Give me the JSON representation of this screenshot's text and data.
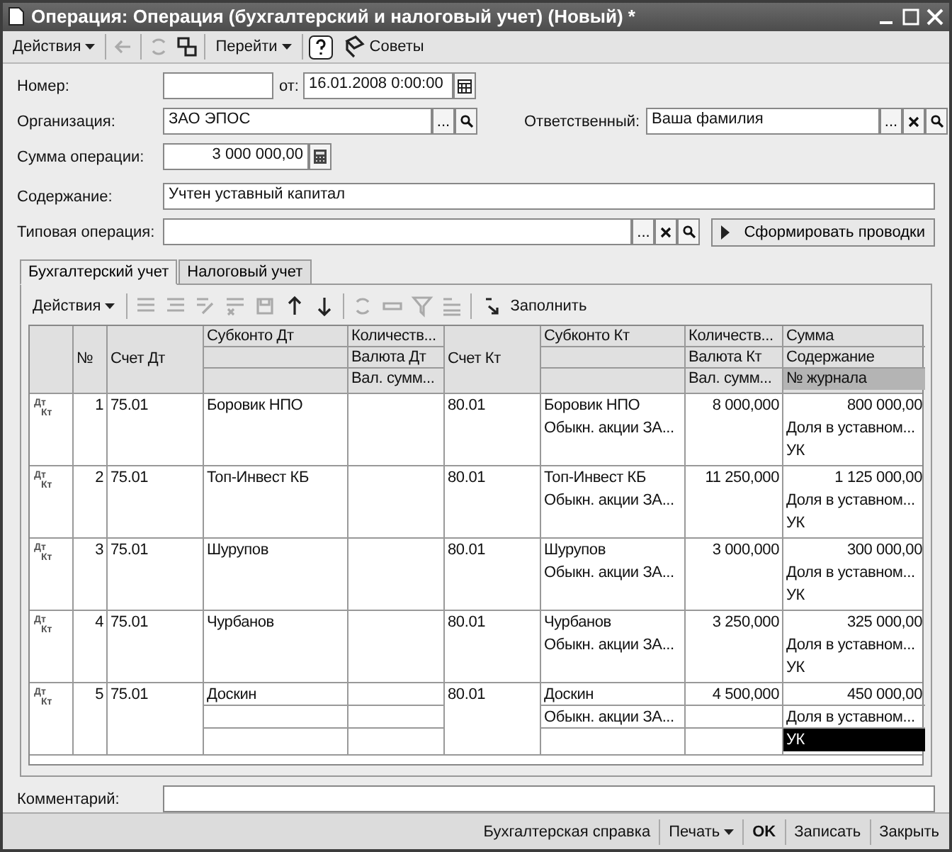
{
  "window": {
    "title": "Операция: Операция (бухгалтерский и налоговый учет) (Новый) *"
  },
  "toolbar": {
    "actions": "Действия",
    "goto": "Перейти",
    "tips": "Советы"
  },
  "form": {
    "number_label": "Номер:",
    "date_label": "от:",
    "date": "16.01.2008  0:00:00",
    "org_label": "Организация:",
    "org": "ЗАО ЭПОС",
    "resp_label": "Ответственный:",
    "resp": "Ваша фамилия",
    "sum_label": "Сумма операции:",
    "sum": "3 000 000,00",
    "content_label": "Содержание:",
    "content": "Учтен уставный капитал",
    "type_label": "Типовая операция:",
    "generate": "Сформировать проводки",
    "ellipsis": "..."
  },
  "tabs": [
    {
      "label": "Бухгалтерский учет",
      "selected": true
    },
    {
      "label": "Налоговый учет",
      "selected": false
    }
  ],
  "table_toolbar": {
    "actions": "Действия",
    "fill": "Заполнить"
  },
  "table": {
    "columns": [
      {
        "kind": "single"
      },
      {
        "kind": "single",
        "lines": [
          "№"
        ]
      },
      {
        "kind": "single",
        "lines": [
          "Счет Дт"
        ]
      },
      {
        "kind": "stacked",
        "lines": [
          "Субконто Дт"
        ]
      },
      {
        "kind": "stacked",
        "lines": [
          "Количеств...",
          "Валюта Дт",
          "Вал. сумм..."
        ]
      },
      {
        "kind": "single",
        "lines": [
          "Счет Кт"
        ]
      },
      {
        "kind": "stacked",
        "lines": [
          "Субконто Кт"
        ]
      },
      {
        "kind": "stacked",
        "lines": [
          "Количеств...",
          "Валюта Кт",
          "Вал. сумм..."
        ]
      },
      {
        "kind": "stacked",
        "lines": [
          "Сумма",
          "Содержание",
          "№ журнала"
        ],
        "sorted": true
      }
    ],
    "rows": [
      {
        "type_mark": [
          "Дт",
          "Кт"
        ],
        "n": "1",
        "dt": "75.01",
        "sub_dt": "Боровик НПО",
        "kt": "80.01",
        "sub_kt": [
          "Боровик НПО",
          "Обыкн. акции ЗА..."
        ],
        "qty": "8 000,000",
        "sum": "800 000,00",
        "text": "Доля в уставном...",
        "journal": "УК",
        "selected": false
      },
      {
        "type_mark": [
          "Дт",
          "Кт"
        ],
        "n": "2",
        "dt": "75.01",
        "sub_dt": "Топ-Инвест КБ",
        "kt": "80.01",
        "sub_kt": [
          "Топ-Инвест КБ",
          "Обыкн. акции ЗА..."
        ],
        "qty": "11 250,000",
        "sum": "1 125 000,00",
        "text": "Доля в уставном...",
        "journal": "УК",
        "selected": false
      },
      {
        "type_mark": [
          "Дт",
          "Кт"
        ],
        "n": "3",
        "dt": "75.01",
        "sub_dt": "Шурупов",
        "kt": "80.01",
        "sub_kt": [
          "Шурупов",
          "Обыкн. акции ЗА..."
        ],
        "qty": "3 000,000",
        "sum": "300 000,00",
        "text": "Доля в уставном...",
        "journal": "УК",
        "selected": false
      },
      {
        "type_mark": [
          "Дт",
          "Кт"
        ],
        "n": "4",
        "dt": "75.01",
        "sub_dt": "Чурбанов",
        "kt": "80.01",
        "sub_kt": [
          "Чурбанов",
          "Обыкн. акции ЗА..."
        ],
        "qty": "3 250,000",
        "sum": "325 000,00",
        "text": "Доля в уставном...",
        "journal": "УК",
        "selected": false
      },
      {
        "type_mark": [
          "Дт",
          "Кт"
        ],
        "n": "5",
        "dt": "75.01",
        "sub_dt": "Доскин",
        "kt": "80.01",
        "sub_kt": [
          "Доскин",
          "Обыкн. акции ЗА..."
        ],
        "qty": "4 500,000",
        "sum": "450 000,00",
        "text": "Доля в уставном...",
        "journal": "УК",
        "selected": true
      }
    ]
  },
  "comment": {
    "label": "Комментарий:"
  },
  "footer": {
    "report": "Бухгалтерская справка",
    "print": "Печать",
    "ok": "OK",
    "save": "Записать",
    "close": "Закрыть"
  }
}
